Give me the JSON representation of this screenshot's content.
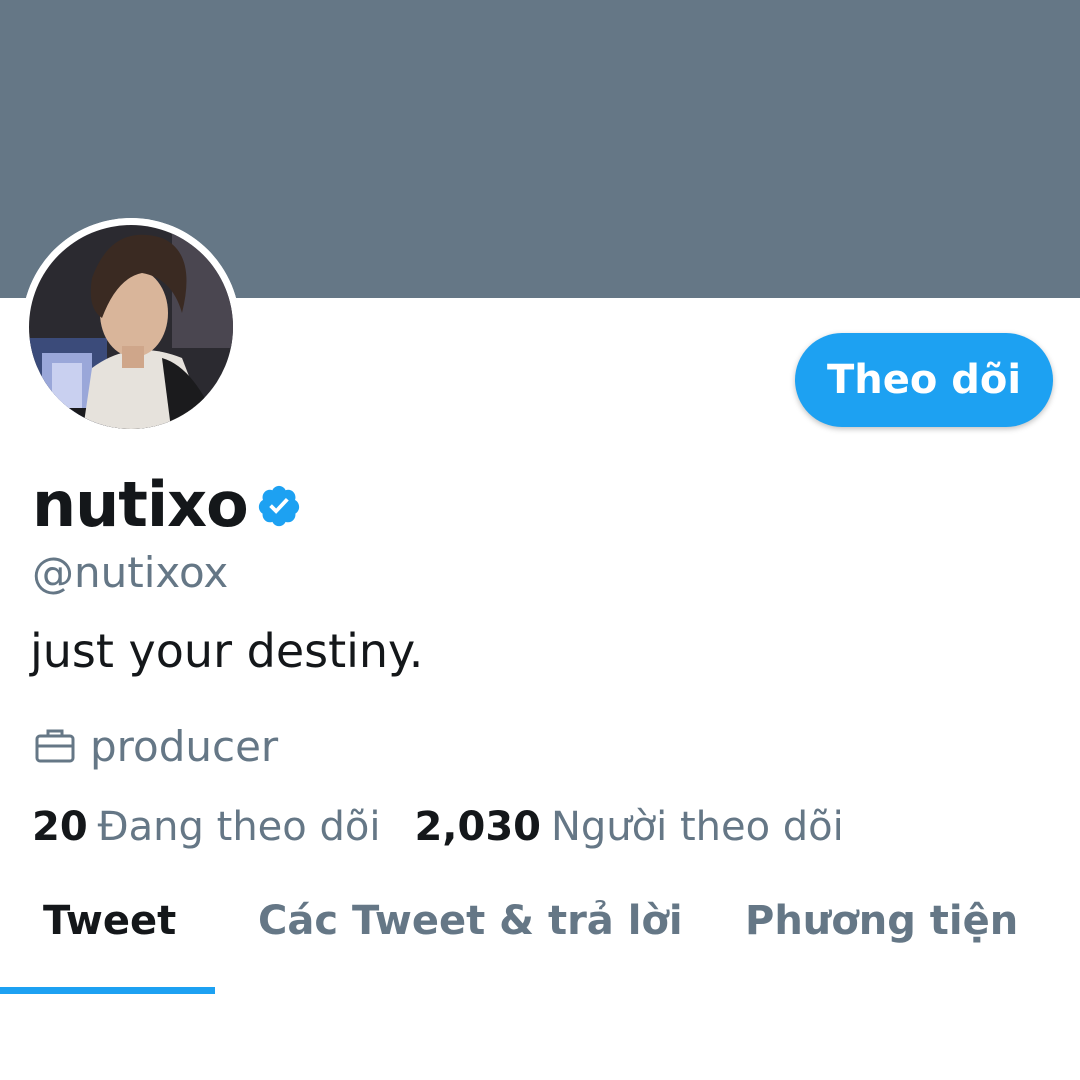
{
  "profile": {
    "display_name": "nutixo",
    "handle": "@nutixox",
    "bio": "just your destiny.",
    "job": "producer",
    "verified": true
  },
  "follow_button": {
    "label": "Theo dõi"
  },
  "stats": {
    "following_count": "20",
    "following_label": "Đang theo dõi",
    "followers_count": "2,030",
    "followers_label": "Người theo dõi"
  },
  "tabs": [
    {
      "label": "Tweet",
      "active": true
    },
    {
      "label": "Các Tweet & trả lời",
      "active": false
    },
    {
      "label": "Phương tiện",
      "active": false
    }
  ],
  "icons": {
    "verified": "verified-badge-icon",
    "job": "briefcase-icon"
  },
  "colors": {
    "accent": "#1da1f2",
    "banner": "#657786",
    "text_primary": "#14171a",
    "text_secondary": "#657786"
  }
}
